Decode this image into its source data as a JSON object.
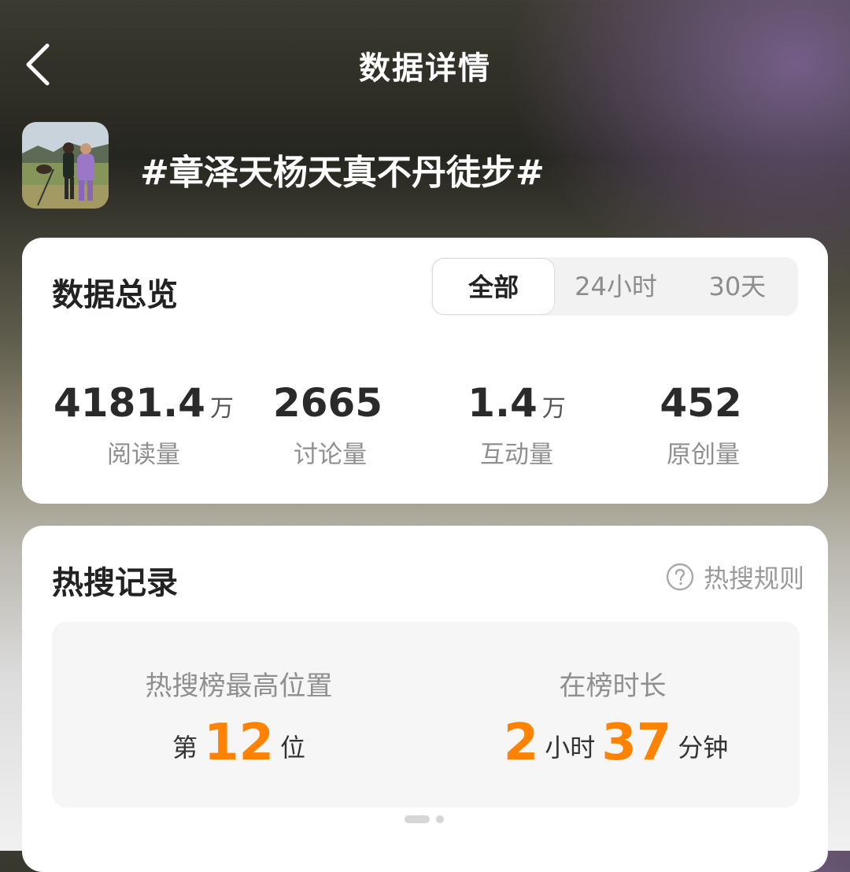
{
  "nav": {
    "title": "数据详情",
    "back_icon": "chevron-left-icon"
  },
  "topic": {
    "name": "#章泽天杨天真不丹徒步#"
  },
  "overview": {
    "title": "数据总览",
    "tabs": [
      {
        "label": "全部",
        "active": true
      },
      {
        "label": "24小时",
        "active": false
      },
      {
        "label": "30天",
        "active": false
      }
    ],
    "stats": [
      {
        "value": "4181.4",
        "unit": "万",
        "label": "阅读量"
      },
      {
        "value": "2665",
        "unit": "",
        "label": "讨论量"
      },
      {
        "value": "1.4",
        "unit": "万",
        "label": "互动量"
      },
      {
        "value": "452",
        "unit": "",
        "label": "原创量"
      }
    ]
  },
  "hot_search": {
    "title": "热搜记录",
    "rules_label": "热搜规则",
    "rules_icon": "question-circle-icon",
    "peak": {
      "label": "热搜榜最高位置",
      "prefix": "第",
      "value": "12",
      "suffix": "位"
    },
    "duration": {
      "label": "在榜时长",
      "hours": "2",
      "hours_unit": "小时",
      "minutes": "37",
      "minutes_unit": "分钟"
    },
    "page_indicator": {
      "pages": 2,
      "current": 1
    }
  },
  "colors": {
    "accent": "#ff8200",
    "card": "#ffffff",
    "text_primary": "#222222",
    "text_secondary": "#8f8f8f"
  }
}
